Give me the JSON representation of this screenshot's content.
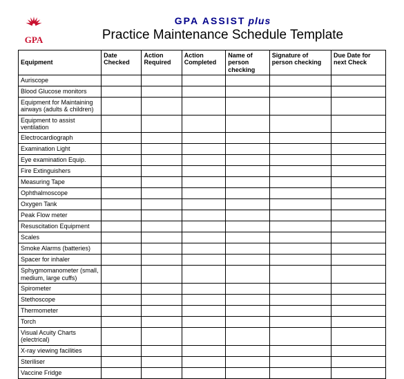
{
  "brand": {
    "name": "GPA ASSIST",
    "suffix": "plus"
  },
  "title": "Practice Maintenance Schedule Template",
  "logo_text": "GPA",
  "columns": [
    "Equipment",
    "Date Checked",
    "Action Required",
    "Action Completed",
    "Name of person checking",
    "Signature of person checking",
    "Due Date for next Check"
  ],
  "rows": [
    "Auriscope",
    "Blood Glucose monitors",
    "Equipment for Maintaining airways (adults & children)",
    "Equipment to assist ventilation",
    "Electrocardiograph",
    "Examination Light",
    "Eye examination Equip.",
    "Fire Extinguishers",
    "Measuring Tape",
    "Ophthalmoscope",
    "Oxygen Tank",
    "Peak Flow meter",
    "Resuscitation Equipment",
    "Scales",
    "Smoke Alarms (batteries)",
    "Spacer for inhaler",
    "Sphygmomanometer (small, medium, large cuffs)",
    "Spirometer",
    "Stethoscope",
    "Thermometer",
    "Torch",
    "Visual Acuity Charts (electrical)",
    "X-ray viewing facilities",
    "Steriliser",
    "Vaccine Fridge"
  ]
}
